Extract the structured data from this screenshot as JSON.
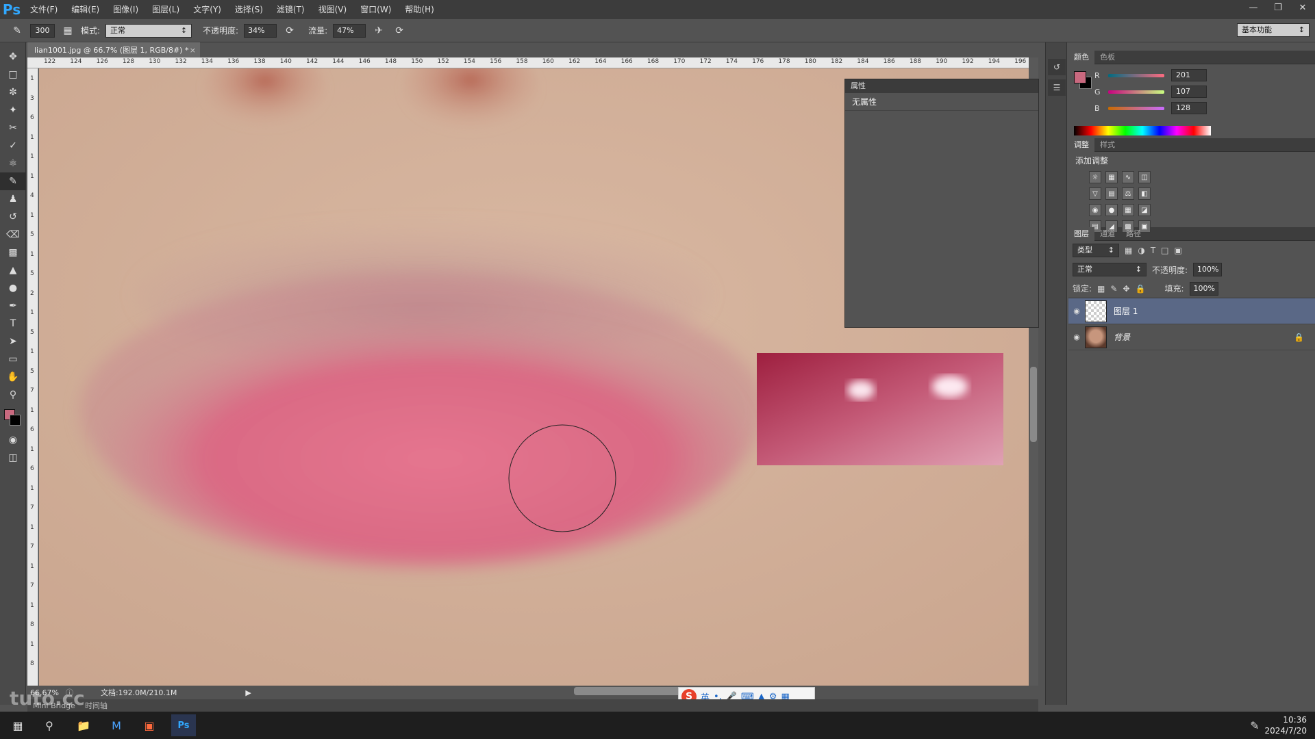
{
  "app": {
    "logo": "Ps"
  },
  "menu": [
    "文件(F)",
    "编辑(E)",
    "图像(I)",
    "图层(L)",
    "文字(Y)",
    "选择(S)",
    "滤镜(T)",
    "视图(V)",
    "窗口(W)",
    "帮助(H)"
  ],
  "options": {
    "brush_size": "300",
    "mode_label": "模式:",
    "mode_value": "正常",
    "opacity_label": "不透明度:",
    "opacity_value": "34%",
    "flow_label": "流量:",
    "flow_value": "47%",
    "workspace": "基本功能"
  },
  "document": {
    "tab_title": "lian1001.jpg @ 66.7% (图层 1, RGB/8#) *",
    "ruler_h": [
      "122",
      "124",
      "126",
      "128",
      "130",
      "132",
      "134",
      "136",
      "138",
      "140",
      "142",
      "144",
      "146",
      "148",
      "150",
      "152",
      "154",
      "156",
      "158",
      "160",
      "162",
      "164",
      "166",
      "168",
      "170",
      "172",
      "174",
      "176",
      "178",
      "180",
      "182",
      "184",
      "186",
      "188",
      "190",
      "192",
      "194",
      "196"
    ],
    "ruler_v": [
      "1",
      "3",
      "6",
      "1",
      "1",
      "1",
      "4",
      "1",
      "5",
      "1",
      "5",
      "2",
      "1",
      "5",
      "1",
      "5",
      "7",
      "1",
      "6",
      "1",
      "6",
      "1",
      "7",
      "1",
      "7",
      "1",
      "7",
      "1",
      "8",
      "1",
      "8"
    ],
    "zoom": "66.67%",
    "doc_size": "文档:192.0M/210.1M"
  },
  "bottom_tabs": [
    "Mini Bridge",
    "时间轴"
  ],
  "properties": {
    "title": "属性",
    "body": "无属性"
  },
  "color_panel": {
    "tabs": [
      "颜色",
      "色板"
    ],
    "fg_color": "#c9697f",
    "r": "201",
    "g": "107",
    "b": "128"
  },
  "adjustments": {
    "tabs": [
      "调整",
      "样式"
    ],
    "title": "添加调整"
  },
  "layers": {
    "tabs": [
      "图层",
      "通道",
      "路径"
    ],
    "filter": "类型",
    "blend": "正常",
    "opacity_label": "不透明度:",
    "opacity": "100%",
    "lock_label": "锁定:",
    "fill_label": "填充:",
    "fill": "100%",
    "items": [
      {
        "name": "图层 1",
        "selected": true
      },
      {
        "name": "背景",
        "selected": false
      }
    ]
  },
  "ime": {
    "lang": "英"
  },
  "clock": {
    "time": "10:36",
    "date": "2024/7/20"
  },
  "watermark": "tuto.cc"
}
